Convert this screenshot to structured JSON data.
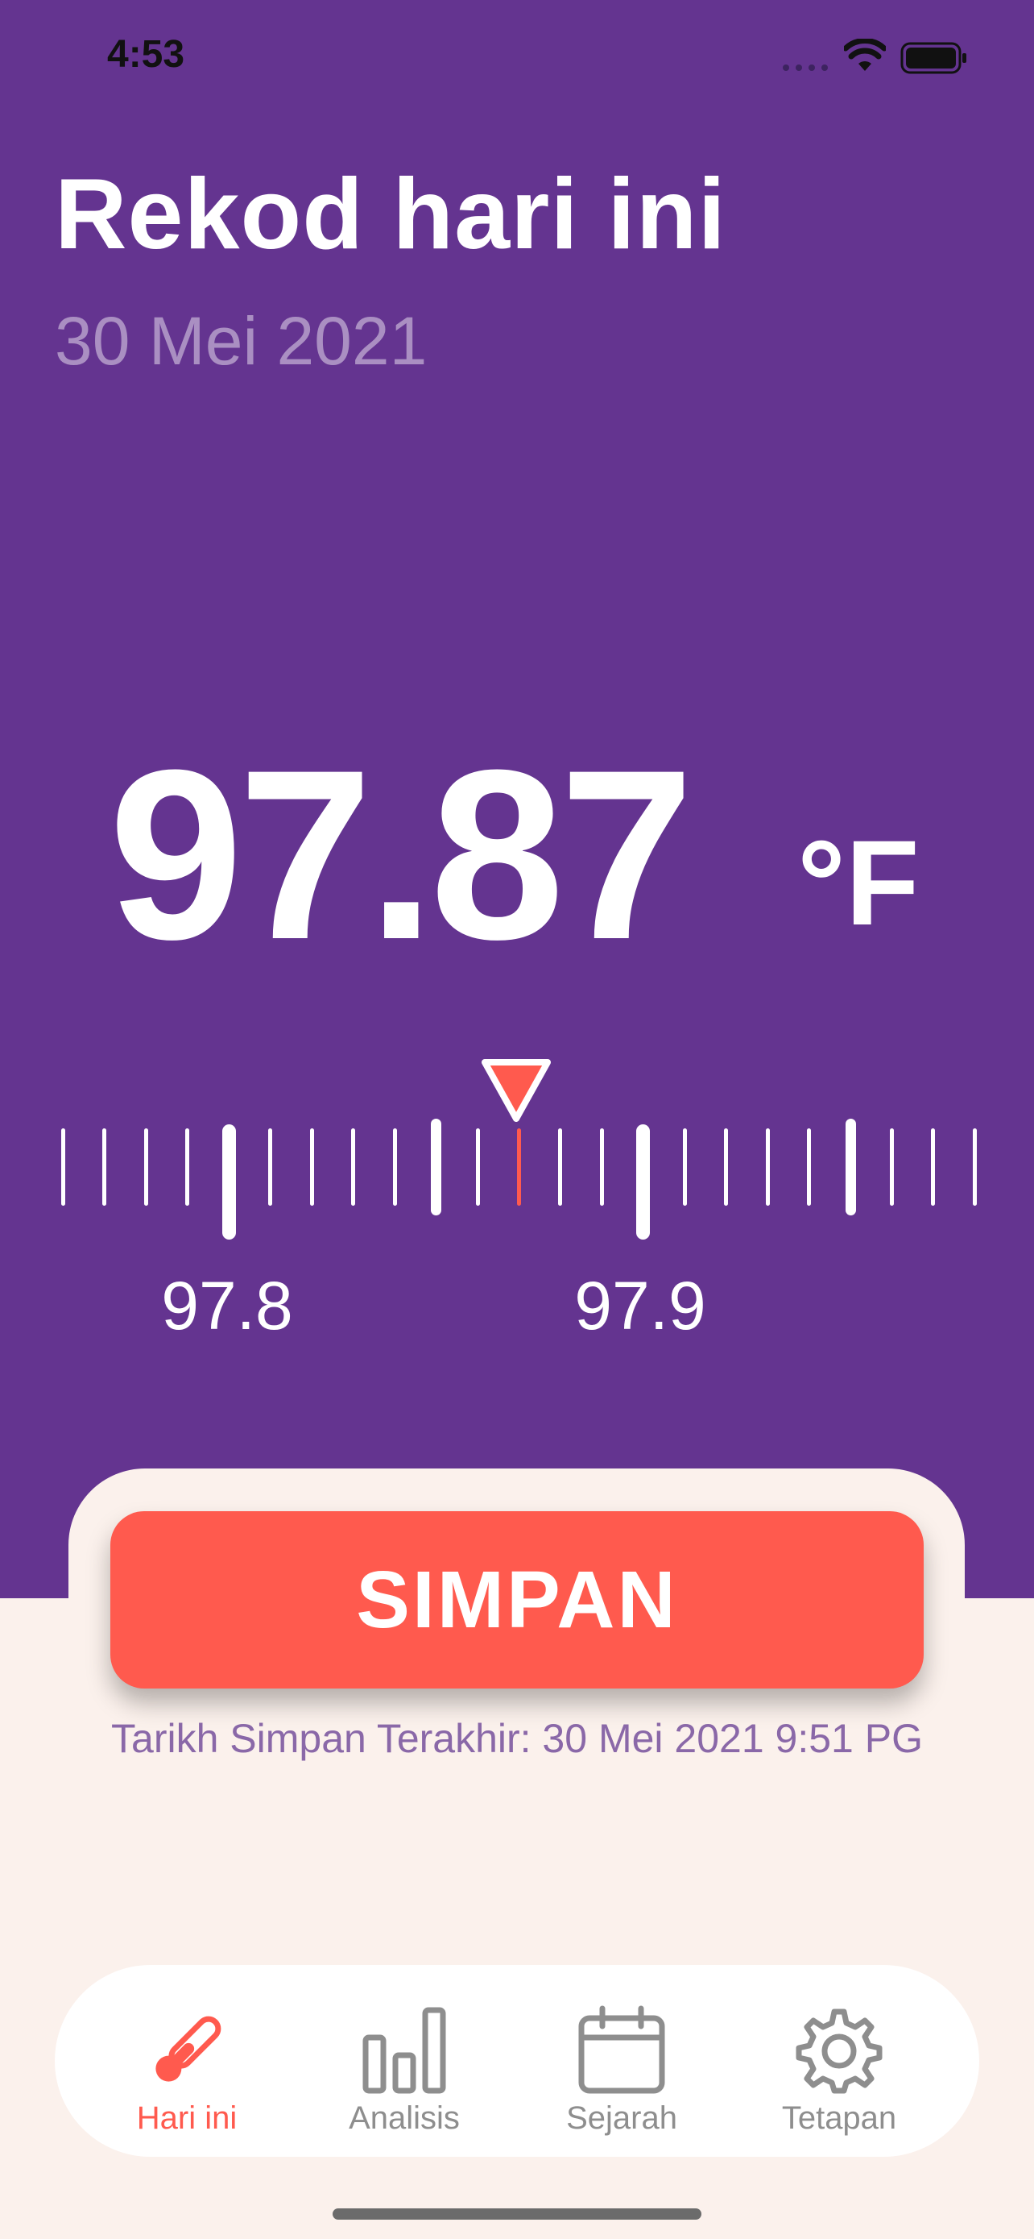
{
  "status_bar": {
    "time": "4:53"
  },
  "header": {
    "title": "Rekod hari ini",
    "date": "30 Mei 2021"
  },
  "reading": {
    "value": "97.87",
    "unit": "°F",
    "accent_color": "#FF5A4E"
  },
  "ruler": {
    "labels": [
      "97.8",
      "97.9"
    ]
  },
  "actions": {
    "save_label": "SIMPAN"
  },
  "last_saved": "Tarikh Simpan Terakhir: 30 Mei 2021 9:51 PG",
  "tabs": [
    {
      "label": "Hari ini",
      "icon": "thermometer-icon",
      "active": true
    },
    {
      "label": "Analisis",
      "icon": "bar-chart-icon",
      "active": false
    },
    {
      "label": "Sejarah",
      "icon": "calendar-icon",
      "active": false
    },
    {
      "label": "Tetapan",
      "icon": "gear-icon",
      "active": false
    }
  ],
  "colors": {
    "primary": "#643490",
    "accent": "#FF5A4E",
    "background": "#FBF1EC",
    "inactive": "#8E8E8E"
  }
}
